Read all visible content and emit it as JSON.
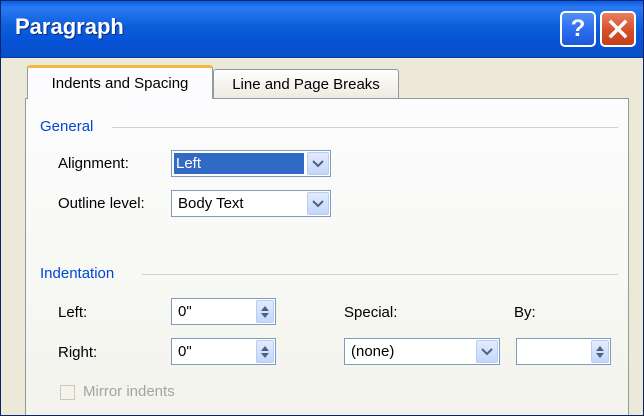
{
  "window": {
    "title": "Paragraph",
    "help_icon": "question-mark-icon",
    "close_icon": "close-x-icon",
    "help_glyph": "?"
  },
  "tabs": [
    {
      "label": "Indents and Spacing",
      "active": true
    },
    {
      "label": "Line and Page Breaks",
      "active": false
    }
  ],
  "general": {
    "title": "General",
    "alignment_label": "Alignment:",
    "alignment_value": "Left",
    "outline_label": "Outline level:",
    "outline_value": "Body Text"
  },
  "indentation": {
    "title": "Indentation",
    "left_label": "Left:",
    "left_value": "0\"",
    "right_label": "Right:",
    "right_value": "0\"",
    "special_label": "Special:",
    "special_value": "(none)",
    "by_label": "By:",
    "by_value": "",
    "mirror_label": "Mirror indents",
    "mirror_checked": false
  },
  "colors": {
    "titlebar": "#0a5be3",
    "group_title": "#0046d5",
    "selection": "#316ac5",
    "tab_accent": "#f5b942"
  }
}
